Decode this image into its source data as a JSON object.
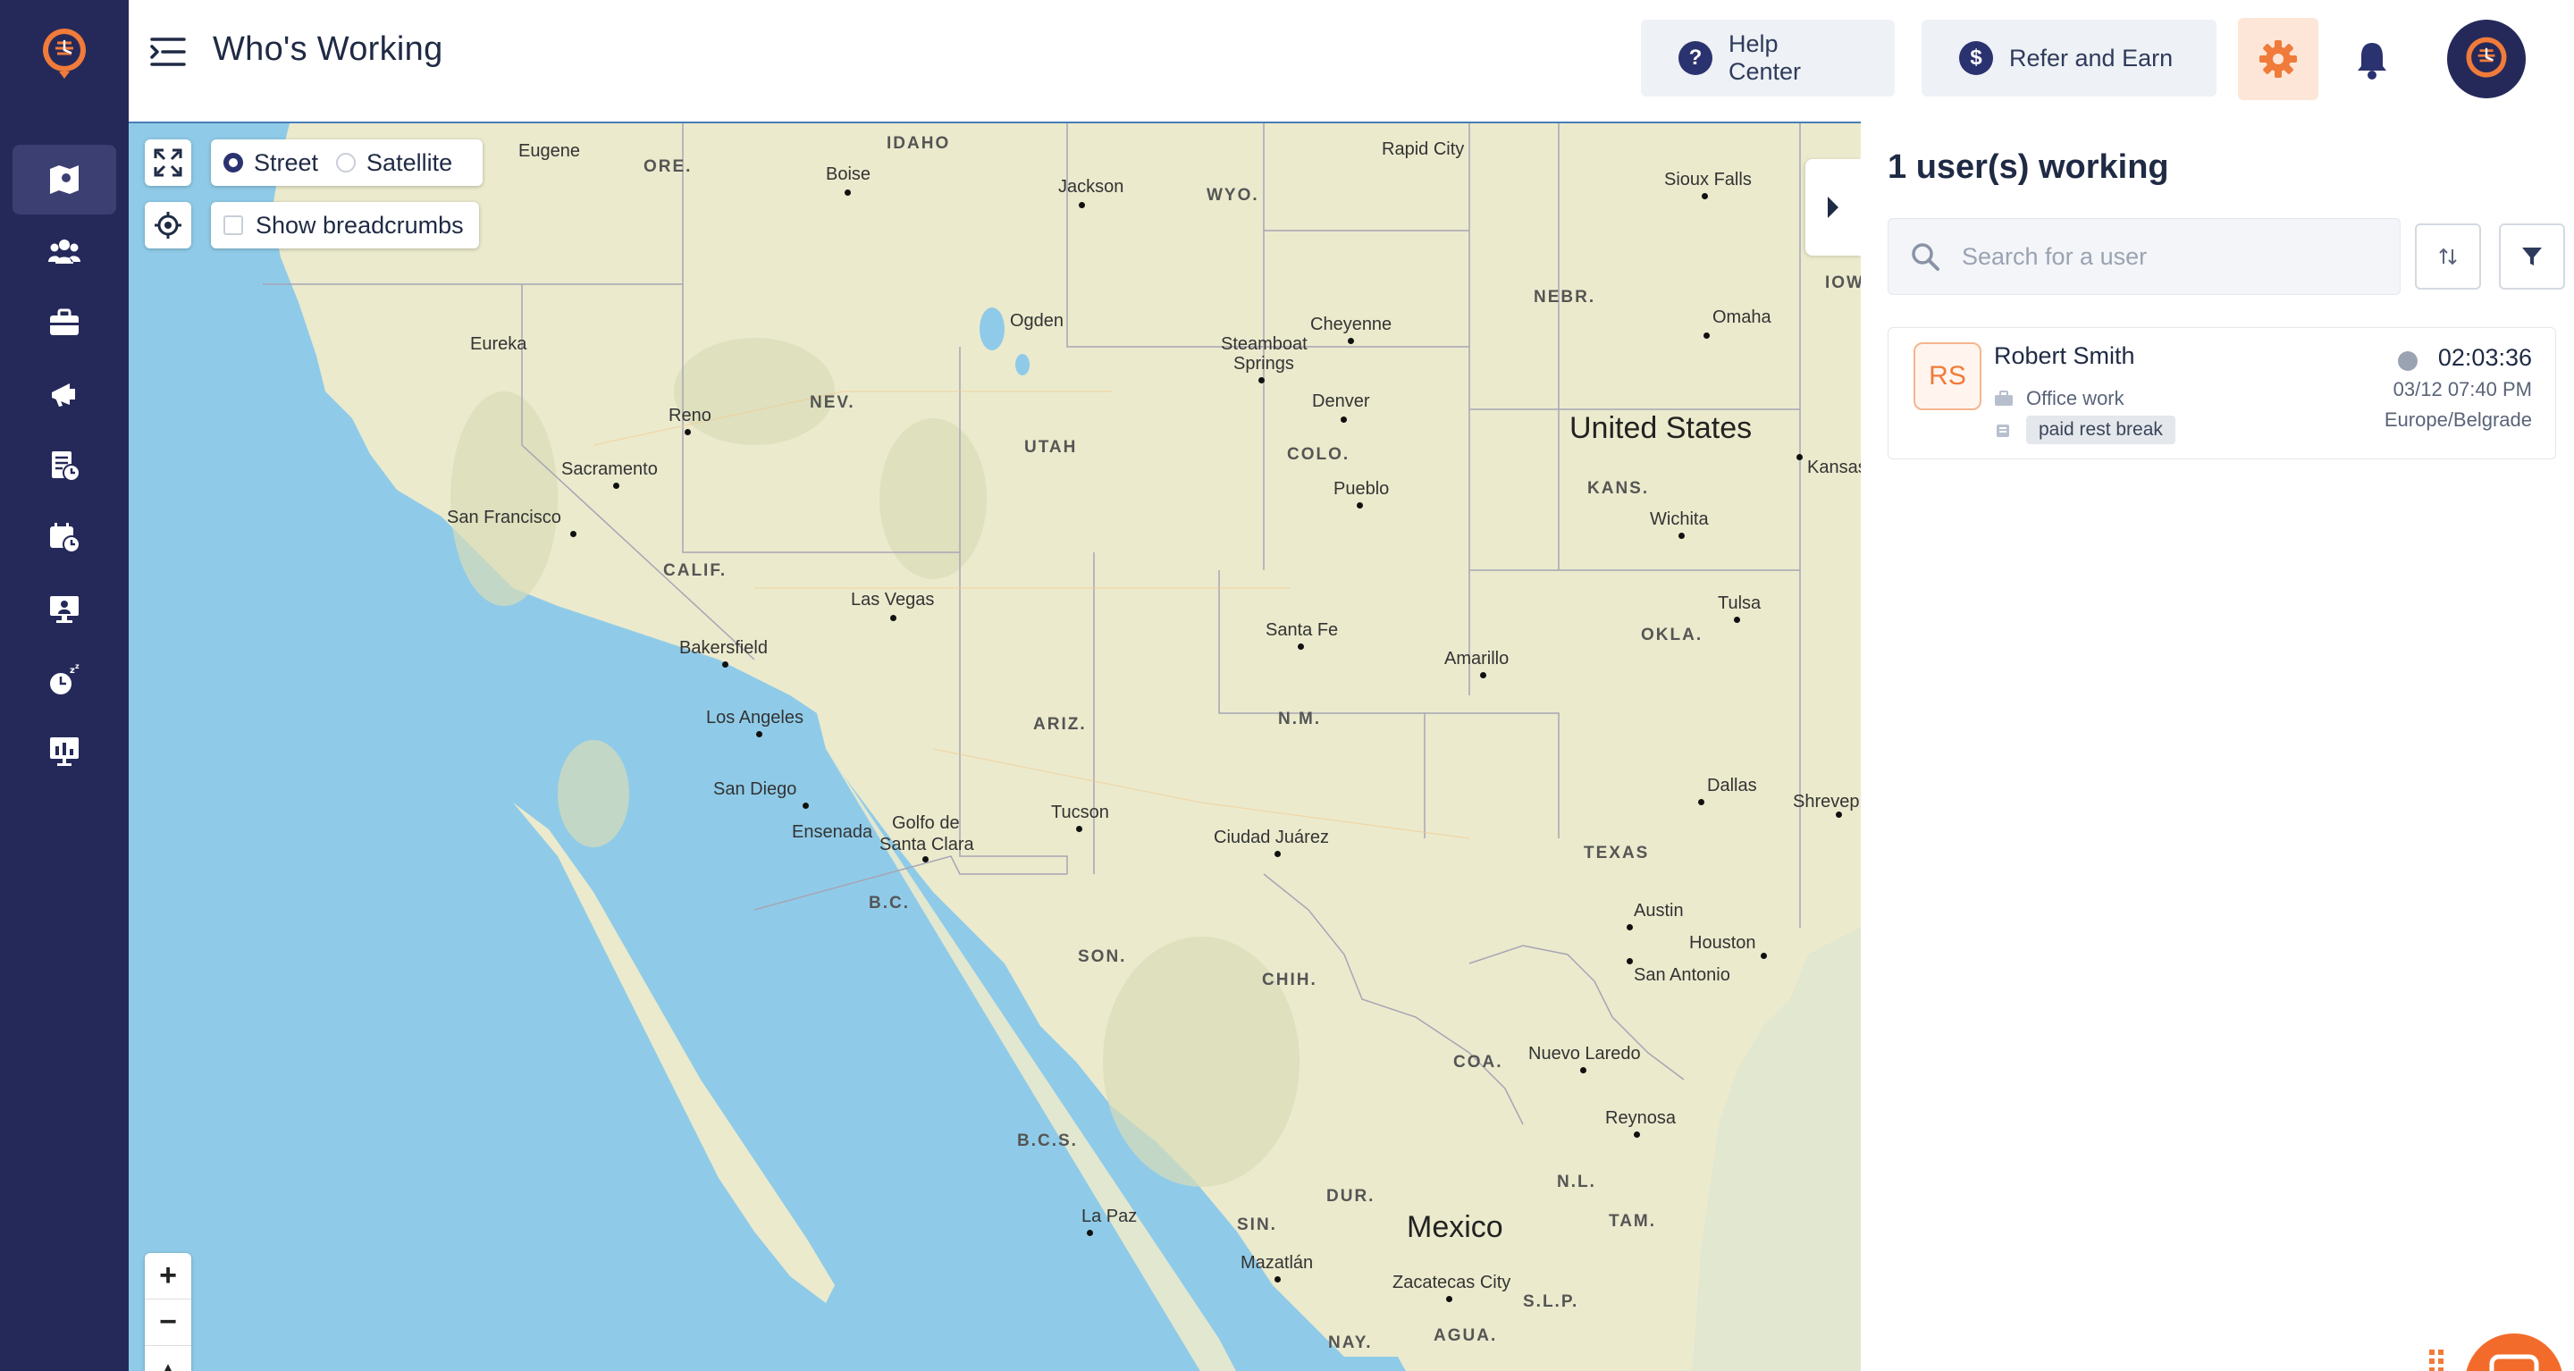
{
  "app": {
    "page_title": "Who's Working"
  },
  "header": {
    "help_label": "Help Center",
    "refer_label": "Refer and Earn",
    "colors": {
      "accent": "#f07b3a",
      "sidebar": "#25295a"
    }
  },
  "sidebar": {
    "items": [
      {
        "icon": "map-icon",
        "active": true
      },
      {
        "icon": "team-icon",
        "active": false
      },
      {
        "icon": "briefcase-icon",
        "active": false
      },
      {
        "icon": "megaphone-icon",
        "active": false
      },
      {
        "icon": "timesheet-icon",
        "active": false
      },
      {
        "icon": "time-off-icon",
        "active": false
      },
      {
        "icon": "kiosk-icon",
        "active": false
      },
      {
        "icon": "sleep-icon",
        "active": false
      },
      {
        "icon": "reports-icon",
        "active": false
      }
    ]
  },
  "map": {
    "layer_options": {
      "street": "Street",
      "satellite": "Satellite",
      "selected": "Street"
    },
    "breadcrumbs_label": "Show breadcrumbs",
    "zoom_in": "+",
    "zoom_out": "−",
    "compass": "▲",
    "labels": {
      "eugene": "Eugene",
      "idaho": "IDAHO",
      "ore": "ORE.",
      "boise": "Boise",
      "jackson": "Jackson",
      "wyo": "WYO.",
      "rapid_city": "Rapid City",
      "sioux_falls": "Sioux Falls",
      "iow": "IOW",
      "nebr": "NEBR.",
      "omaha": "Omaha",
      "eureka": "Eureka",
      "ogden": "Ogden",
      "steamboat": "Steamboat",
      "springs": "Springs",
      "cheyenne": "Cheyenne",
      "nev": "NEV.",
      "reno": "Reno",
      "utah": "UTAH",
      "denver": "Denver",
      "colo": "COLO.",
      "united_states": "United States",
      "kansas": "Kansas",
      "kans": "KANS.",
      "sacramento": "Sacramento",
      "pueblo": "Pueblo",
      "wichita": "Wichita",
      "san_francisco": "San Francisco",
      "calif": "CALIF.",
      "las_vegas": "Las Vegas",
      "tulsa": "Tulsa",
      "santa_fe": "Santa Fe",
      "okla": "OKLA.",
      "amarillo": "Amarillo",
      "bakersfield": "Bakersfield",
      "los_angeles": "Los Angeles",
      "ariz": "ARIZ.",
      "nm": "N.M.",
      "dallas": "Dallas",
      "shreveport": "Shrevep",
      "san_diego": "San Diego",
      "tucson": "Tucson",
      "golfo": "Golfo de",
      "santa_clara": "Santa Clara",
      "ensenada": "Ensenada",
      "ciudad_juarez": "Ciudad Juárez",
      "texas": "TEXAS",
      "bc": "B.C.",
      "son": "SON.",
      "austin": "Austin",
      "houston": "Houston",
      "chih": "CHIH.",
      "san_antonio": "San Antonio",
      "coa": "COA.",
      "nuevo_laredo": "Nuevo Laredo",
      "reynosa": "Reynosa",
      "bcs": "B.C.S.",
      "nl": "N.L.",
      "dur": "DUR.",
      "tam": "TAM.",
      "la_paz": "La Paz",
      "sin": "SIN.",
      "mexico": "Mexico",
      "mazatlan": "Mazatlán",
      "zacatecas": "Zacatecas City",
      "slp": "S.L.P.",
      "nay": "NAY.",
      "agua": "AGUA."
    }
  },
  "panel": {
    "title": "1 user(s) working",
    "search_placeholder": "Search for a user",
    "users": [
      {
        "initials": "RS",
        "name": "Robert Smith",
        "job": "Office work",
        "break": "paid rest break",
        "duration": "02:03:36",
        "started": "03/12 07:40 PM",
        "timezone": "Europe/Belgrade"
      }
    ]
  }
}
